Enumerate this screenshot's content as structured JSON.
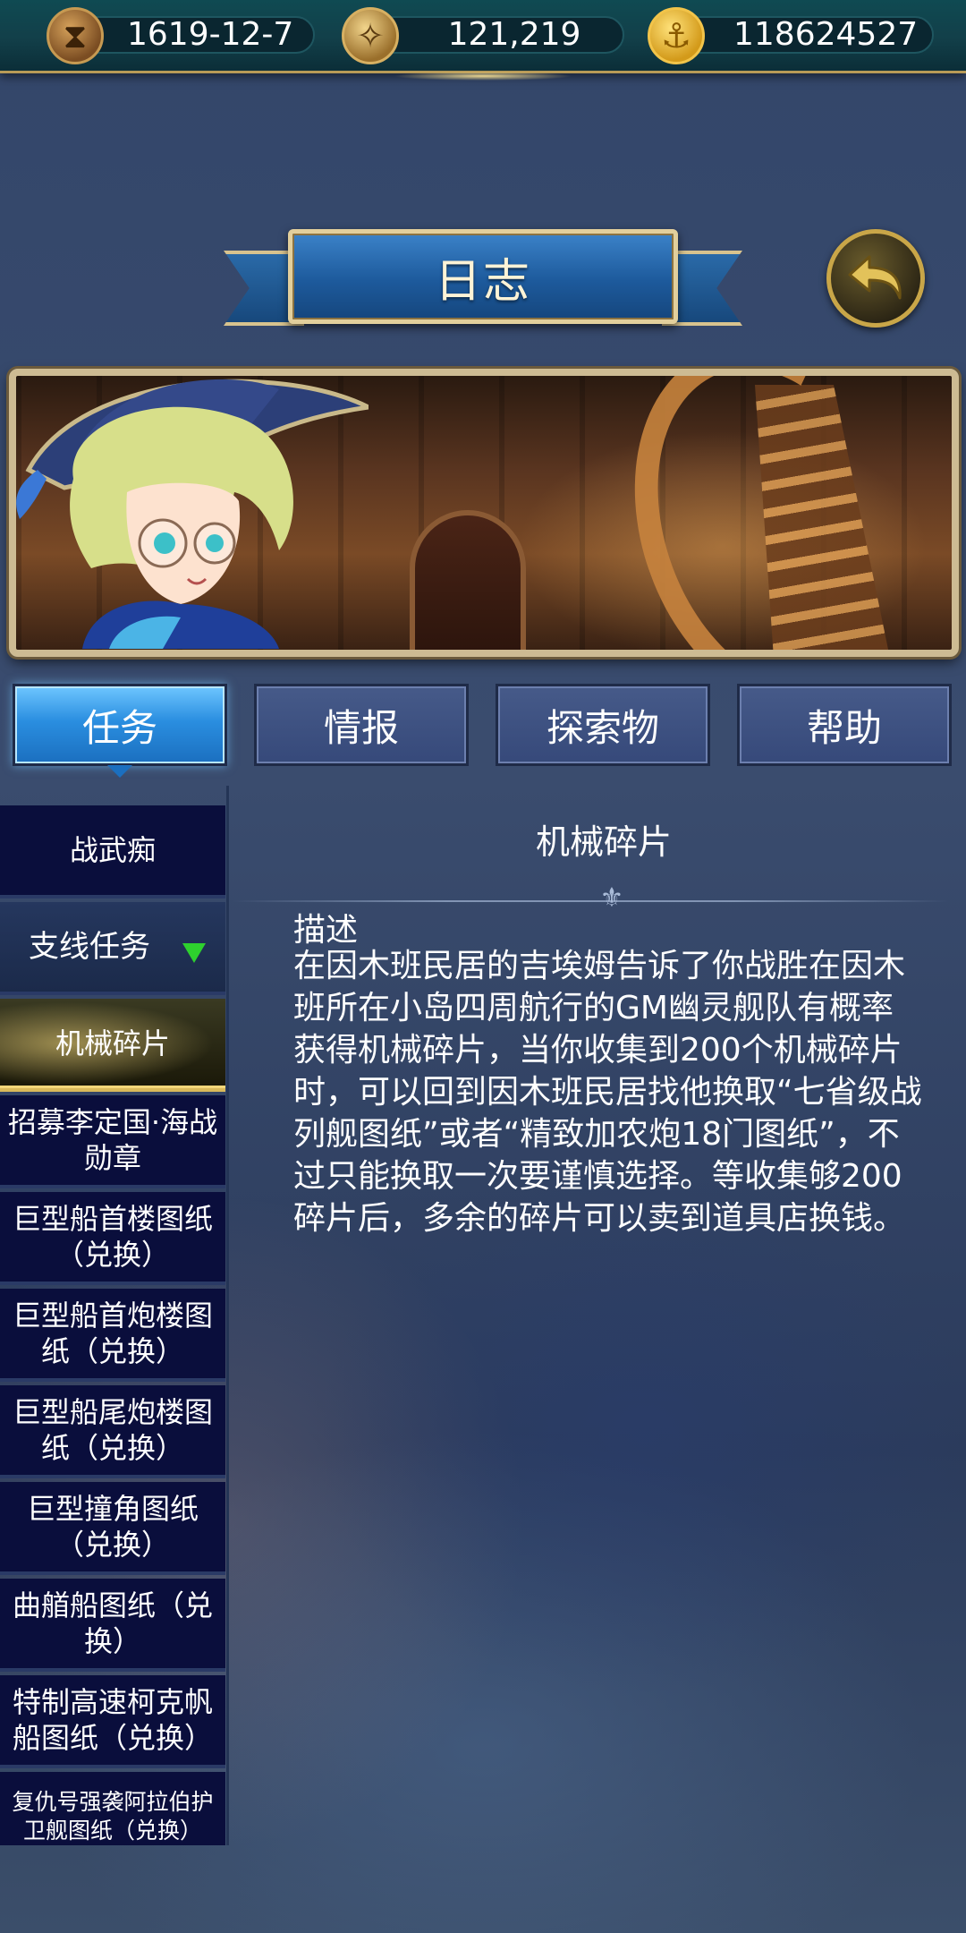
{
  "resources": {
    "date": "1619-12-7",
    "compass_value": "121,219",
    "gold": "118624527",
    "icons": [
      "hourglass-icon",
      "compass-icon",
      "anchor-coin-icon"
    ]
  },
  "header": {
    "title": "日志"
  },
  "tabs": [
    {
      "label": "任务",
      "active": true
    },
    {
      "label": "情报",
      "active": false
    },
    {
      "label": "探索物",
      "active": false
    },
    {
      "label": "帮助",
      "active": false
    }
  ],
  "quest_list": [
    {
      "label": "战武痴"
    },
    {
      "label": "支线任务",
      "category": true
    },
    {
      "label": "机械碎片",
      "selected": true
    },
    {
      "label": "招募李定国·海战勋章"
    },
    {
      "label": "巨型船首楼图纸（兑换）"
    },
    {
      "label": "巨型船首炮楼图纸（兑换）"
    },
    {
      "label": "巨型船尾炮楼图纸（兑换）"
    },
    {
      "label": "巨型撞角图纸（兑换）"
    },
    {
      "label": "曲艏船图纸（兑换）"
    },
    {
      "label": "特制高速柯克帆船图纸（兑换）"
    },
    {
      "label": "复仇号强袭阿拉伯护卫舰图纸（兑换）"
    }
  ],
  "detail": {
    "title": "机械碎片",
    "section_label": "描述",
    "description": "在因木班民居的吉埃姆告诉了你战胜在因木班所在小岛四周航行的GM幽灵舰队有概率获得机械碎片，当你收集到200个机械碎片时，可以回到因木班民居找他换取“七省级战列舰图纸”或者“精致加农炮18门图纸”，不过只能换取一次要谨慎选择。等收集够200碎片后，多余的碎片可以卖到道具店换钱。"
  },
  "colors": {
    "active_tab": "#2a8ee0",
    "tab": "#3f5283",
    "list_bg": "#0a0e3c",
    "category_arrow": "#2ed12e",
    "banner": "#1d5a9c"
  }
}
